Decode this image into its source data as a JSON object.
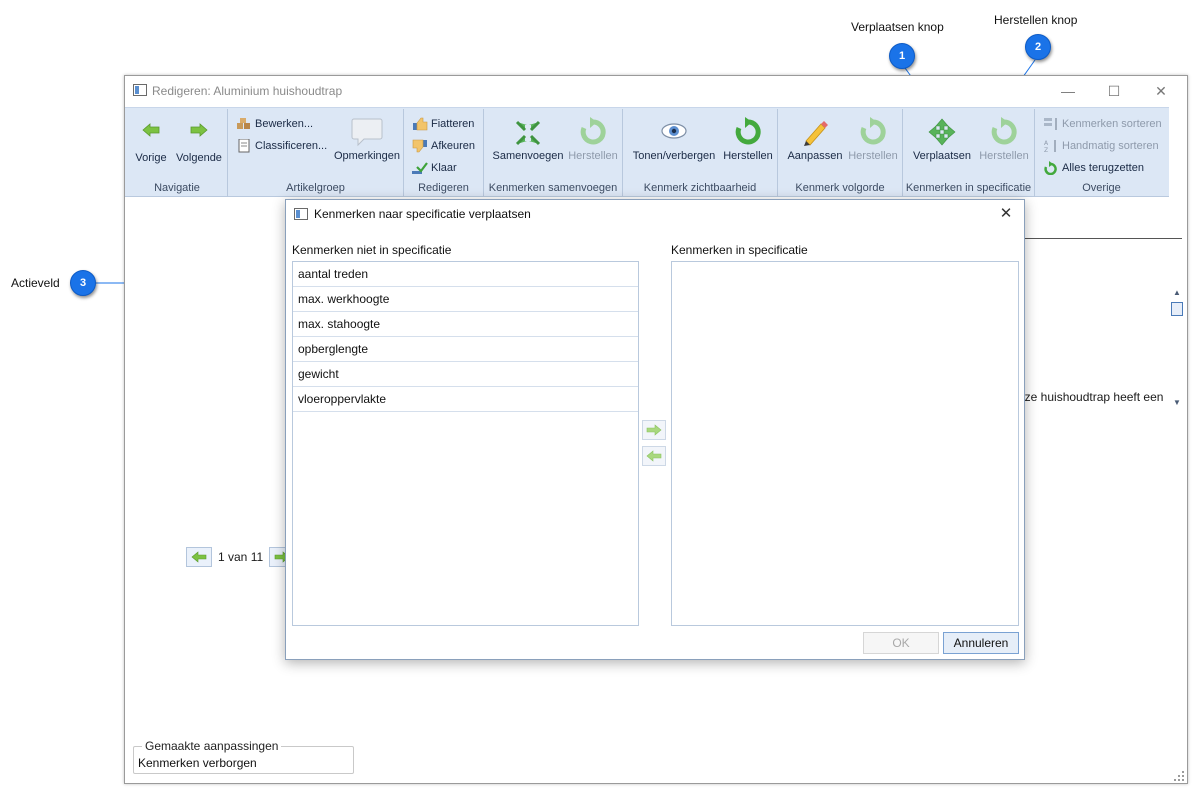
{
  "callouts": [
    {
      "number": "1",
      "label": "Verplaatsen knop"
    },
    {
      "number": "2",
      "label": "Herstellen knop"
    },
    {
      "number": "3",
      "label": "Actieveld"
    }
  ],
  "window": {
    "title": "Redigeren: Aluminium huishoudtrap",
    "controls": {
      "minimize": "—",
      "maximize": "☐",
      "close": "✕"
    }
  },
  "ribbon": {
    "navigatie": {
      "label": "Navigatie",
      "vorige": "Vorige",
      "volgende": "Volgende"
    },
    "artikelgroep": {
      "label": "Artikelgroep",
      "bewerken": "Bewerken...",
      "classificeren": "Classificeren...",
      "opmerkingen": "Opmerkingen"
    },
    "redigeren": {
      "label": "Redigeren",
      "fiatteren": "Fiatteren",
      "afkeuren": "Afkeuren",
      "klaar": "Klaar"
    },
    "samenvoegen": {
      "label": "Kenmerken samenvoegen",
      "samenvoegen": "Samenvoegen",
      "herstellen": "Herstellen"
    },
    "zichtbaarheid": {
      "label": "Kenmerk zichtbaarheid",
      "tonen": "Tonen/verbergen",
      "herstellen": "Herstellen"
    },
    "volgorde": {
      "label": "Kenmerk volgorde",
      "aanpassen": "Aanpassen",
      "herstellen": "Herstellen"
    },
    "specificatie": {
      "label": "Kenmerken in specificatie",
      "verplaatsen": "Verplaatsen",
      "herstellen": "Herstellen"
    },
    "overige": {
      "label": "Overige",
      "sorteren": "Kenmerken sorteren",
      "handmatig": "Handmatig sorteren",
      "terugzetten": "Alles terugzetten"
    }
  },
  "content": {
    "pager_text": "1 van 11",
    "description_fragment": "eze huishoudtrap heeft een",
    "changes": {
      "legend": "Gemaakte aanpassingen",
      "value": "Kenmerken verborgen"
    }
  },
  "dialog": {
    "title": "Kenmerken naar specificatie verplaatsen",
    "close": "✕",
    "left_label": "Kenmerken niet in specificatie",
    "right_label": "Kenmerken in specificatie",
    "left_items": [
      "aantal treden",
      "max. werkhoogte",
      "max. stahoogte",
      "opberglengte",
      "gewicht",
      "vloeroppervlakte"
    ],
    "right_items": [],
    "ok": "OK",
    "cancel": "Annuleren"
  },
  "colors": {
    "ribbon": "#dce7f5",
    "callout": "#1a73e8",
    "green_arrow": "#7cc242"
  }
}
